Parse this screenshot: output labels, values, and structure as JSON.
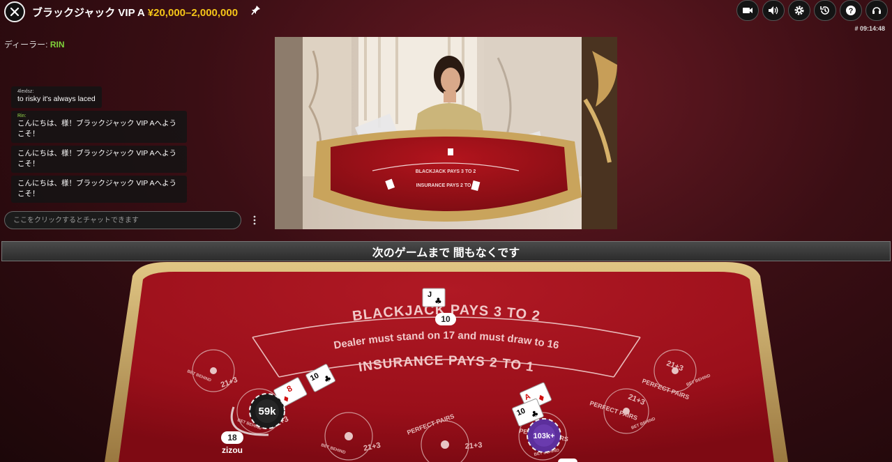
{
  "header": {
    "title": "ブラックジャック VIP A",
    "limits": "¥20,000–2,000,000",
    "round_id": "# 09:14:48"
  },
  "icons": {
    "close": "close-icon",
    "pin": "pin-icon",
    "video": "video-camera-icon",
    "sound": "speaker-icon",
    "settings": "gear-icon",
    "history": "history-icon",
    "help": "help-icon",
    "support": "headset-icon",
    "more": "kebab-menu-icon"
  },
  "dealer": {
    "label": "ディーラー:",
    "name": "RIN"
  },
  "chat": {
    "messages": [
      {
        "user": "4lexlsz:",
        "text": "to risky it's always laced"
      },
      {
        "user": "Rin:",
        "text": "こんにちは、様！ブラックジャック VIP Aへようこそ！"
      },
      {
        "user": "",
        "text": "こんにちは、様！ブラックジャック VIP Aへようこそ！"
      },
      {
        "user": "",
        "text": "こんにちは、様！ブラックジャック VIP Aへようこそ！"
      }
    ],
    "placeholder": "ここをクリックするとチャットできます"
  },
  "status": {
    "text": "次のゲームまで 間もなくです"
  },
  "table": {
    "felt_line1": "BLACKJACK PAYS 3 TO 2",
    "felt_line2": "Dealer must stand on 17 and must draw to 16",
    "felt_line3": "INSURANCE PAYS 2 TO 1",
    "side_bet_21": "21+3",
    "side_bet_pp": "PERFECT PAIRS",
    "bet_behind": "BET BEHIND",
    "dealer_hand": {
      "cards": [
        {
          "rank": "J",
          "suit": "♣"
        }
      ],
      "total": "10"
    },
    "player_hands": [
      {
        "cards": [
          {
            "rank": "10",
            "suit": "♣"
          },
          {
            "rank": "8",
            "suit": "♦"
          }
        ],
        "total": "18",
        "name": "zizou",
        "chip": "59k"
      },
      {
        "cards": [
          {
            "rank": "A",
            "suit": "♦"
          },
          {
            "rank": "10",
            "suit": "♣"
          }
        ],
        "chip": "103k+"
      }
    ]
  },
  "colors": {
    "accent_gold": "#f5c518",
    "dealer_green": "#7fd43a",
    "felt_red": "#a8141f",
    "rail_gold": "#c9a45c"
  }
}
